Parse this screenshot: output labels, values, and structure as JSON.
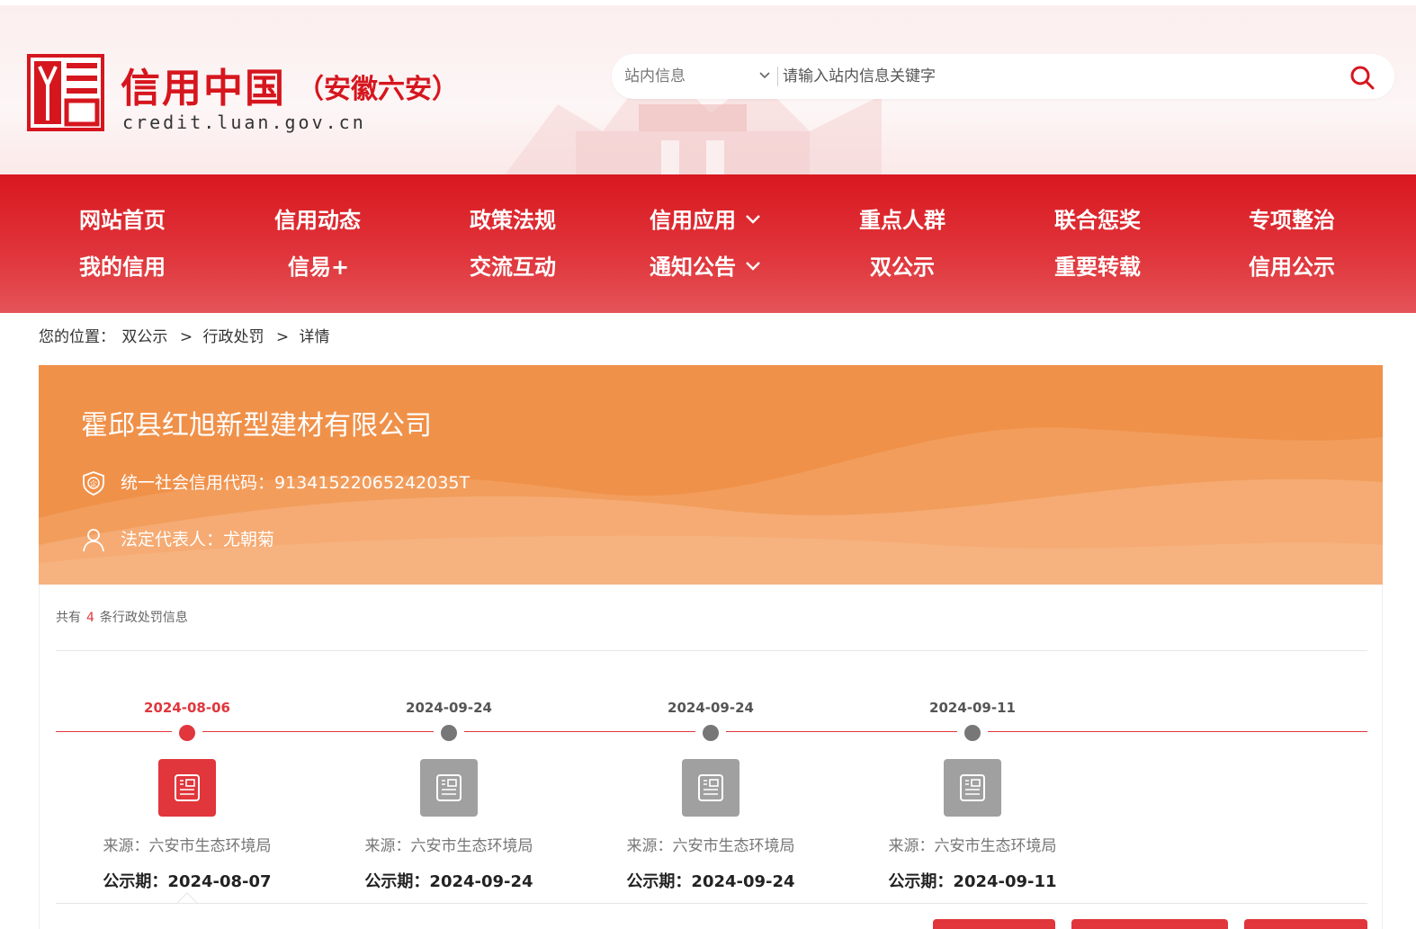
{
  "header": {
    "title": "信用中国",
    "subtitle": "（安徽六安）",
    "domain": "credit.luan.gov.cn",
    "search": {
      "scope": "站内信息",
      "placeholder": "请输入站内信息关键字"
    },
    "logo_icon": "credit-china-logo-icon",
    "search_icon": "search-icon"
  },
  "nav": {
    "items": [
      {
        "label": "网站首页"
      },
      {
        "label": "信用动态"
      },
      {
        "label": "政策法规"
      },
      {
        "label": "信用应用",
        "dropdown": true
      },
      {
        "label": "重点人群"
      },
      {
        "label": "联合惩奖"
      },
      {
        "label": "专项整治"
      },
      {
        "label": "我的信用"
      },
      {
        "label": "信易+"
      },
      {
        "label": "交流互动"
      },
      {
        "label": "通知公告",
        "dropdown": true
      },
      {
        "label": "双公示"
      },
      {
        "label": "重要转载"
      },
      {
        "label": "信用公示"
      }
    ]
  },
  "breadcrumb": {
    "prefix": "您的位置：",
    "items": [
      "双公示",
      "行政处罚",
      "详情"
    ],
    "separator": ">"
  },
  "company": {
    "name": "霍邱县红旭新型建材有限公司",
    "credit_code": "统一社会信用代码：91341522065242035T",
    "legal_rep": "法定代表人：尤朝菊"
  },
  "records": {
    "count_prefix": "共有",
    "count": "4",
    "count_suffix": "条行政处罚信息",
    "items": [
      {
        "date": "2024-08-06",
        "source": "来源：六安市生态环境局",
        "period": "公示期：2024-08-07",
        "active": true
      },
      {
        "date": "2024-09-24",
        "source": "来源：六安市生态环境局",
        "period": "公示期：2024-09-24",
        "active": false
      },
      {
        "date": "2024-09-24",
        "source": "来源：六安市生态环境局",
        "period": "公示期：2024-09-24",
        "active": false
      },
      {
        "date": "2024-09-11",
        "source": "来源：六安市生态环境局",
        "period": "公示期：2024-09-11",
        "active": false
      }
    ]
  },
  "colors": {
    "brand_red": "#d6161e",
    "accent_red": "#e0363c",
    "banner_orange": "#f0914a",
    "inactive_gray": "#a0a0a0"
  }
}
